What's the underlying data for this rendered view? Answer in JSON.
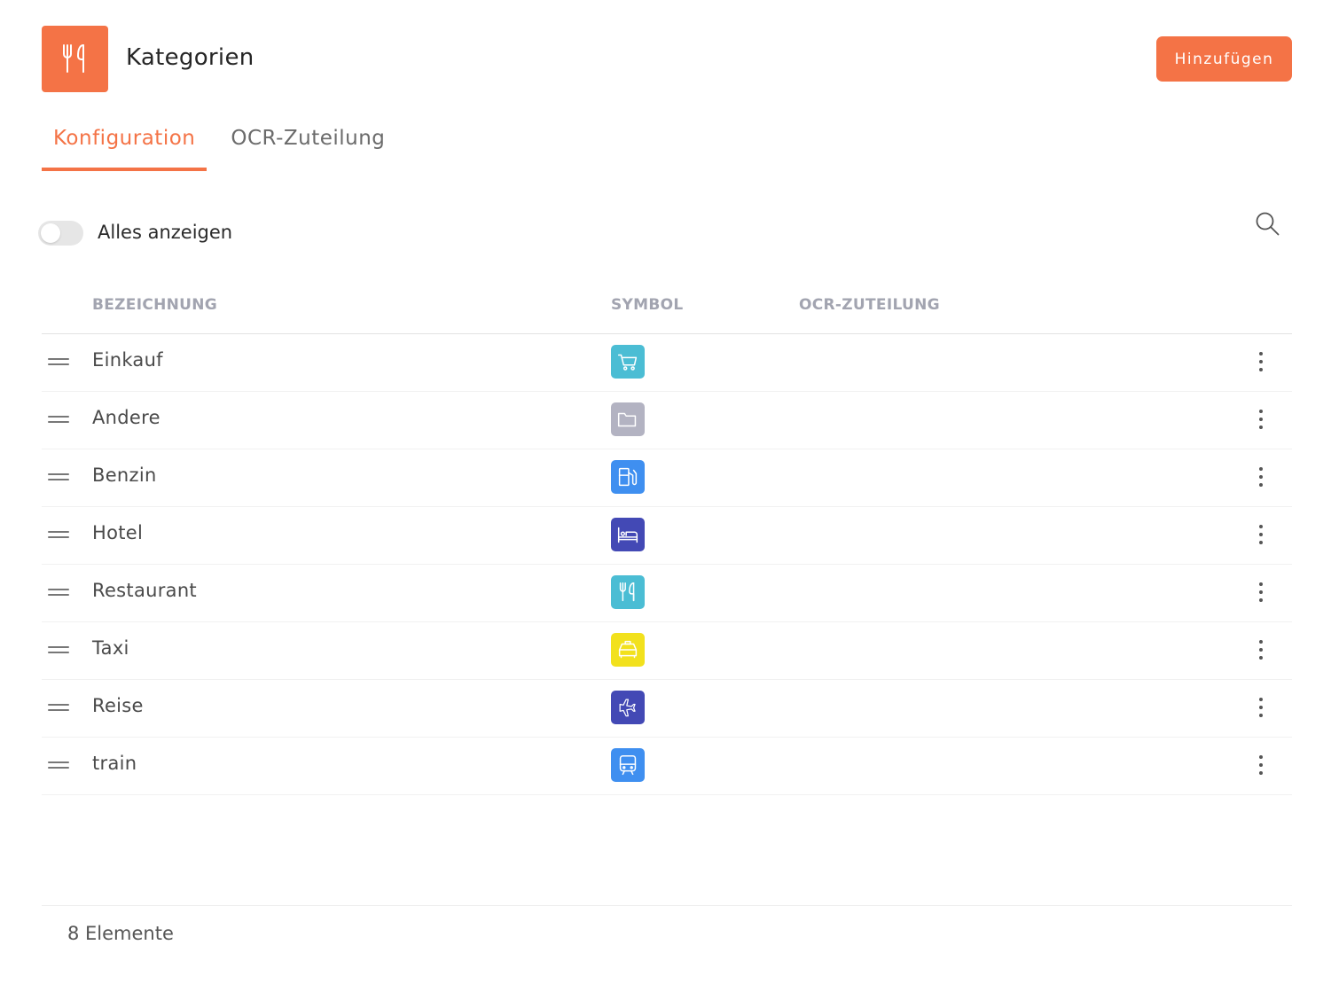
{
  "header": {
    "title": "Kategorien",
    "app_icon": "fork-knife-icon",
    "accent_color": "#f47346",
    "add_button_label": "Hinzufügen"
  },
  "tabs": [
    {
      "label": "Konfiguration",
      "active": true
    },
    {
      "label": "OCR-Zuteilung",
      "active": false
    }
  ],
  "filter": {
    "toggle_label": "Alles anzeigen",
    "toggle_on": false,
    "search_icon": "search-icon"
  },
  "table": {
    "columns": {
      "name": "BEZEICHNUNG",
      "symbol": "SYMBOL",
      "ocr": "OCR-ZUTEILUNG"
    },
    "rows": [
      {
        "name": "Einkauf",
        "icon": "cart-icon",
        "color": "#4bbdd4",
        "ocr": ""
      },
      {
        "name": "Andere",
        "icon": "folder-icon",
        "color": "#b3b3c2",
        "ocr": ""
      },
      {
        "name": "Benzin",
        "icon": "fuel-pump-icon",
        "color": "#3f8ff0",
        "ocr": ""
      },
      {
        "name": "Hotel",
        "icon": "bed-icon",
        "color": "#4349b5",
        "ocr": ""
      },
      {
        "name": "Restaurant",
        "icon": "fork-knife-icon",
        "color": "#4bbdd4",
        "ocr": ""
      },
      {
        "name": "Taxi",
        "icon": "taxi-icon",
        "color": "#f2e11d",
        "ocr": ""
      },
      {
        "name": "Reise",
        "icon": "airplane-icon",
        "color": "#4349b5",
        "ocr": ""
      },
      {
        "name": "train",
        "icon": "train-icon",
        "color": "#3f8ff0",
        "ocr": ""
      }
    ]
  },
  "footer": {
    "count_label": "8 Elemente"
  }
}
